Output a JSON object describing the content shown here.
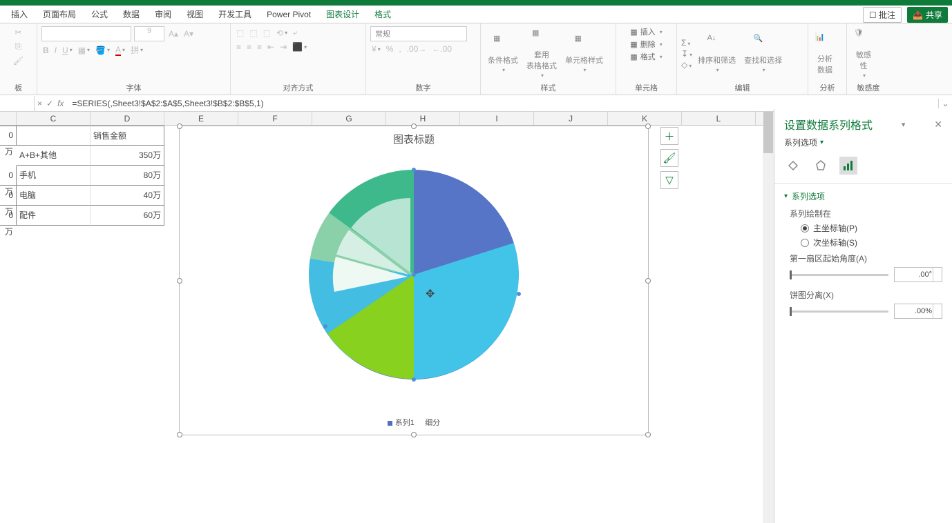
{
  "tabs": [
    "插入",
    "页面布局",
    "公式",
    "数据",
    "审阅",
    "视图",
    "开发工具",
    "Power Pivot",
    "图表设计",
    "格式"
  ],
  "title_right": {
    "comments": "批注",
    "share": "共享"
  },
  "ribbon": {
    "font_size": "9",
    "number_format": "常规",
    "groups": {
      "clipboard": "板",
      "font": "字体",
      "align": "对齐方式",
      "number": "数字",
      "styles": "样式",
      "cells": "单元格",
      "editing": "编辑",
      "analysis": "分析",
      "sensitivity": "敏感度"
    },
    "cond_fmt": "条件格式",
    "table_fmt": "套用\n表格格式",
    "cell_style": "单元格样式",
    "insert": "插入",
    "delete": "删除",
    "format": "格式",
    "sort": "排序和筛选",
    "find": "查找和选择",
    "analyze": "分析\n数据",
    "sens": "敏感\n性"
  },
  "formula_bar": "=SERIES(,Sheet3!$A$2:$A$5,Sheet3!$B$2:$B$5,1)",
  "columns": [
    "C",
    "D",
    "E",
    "F",
    "G",
    "H",
    "I",
    "J",
    "K",
    "L"
  ],
  "table": {
    "header_col2": "销售金额",
    "rows": [
      {
        "a": "0万",
        "c": "A+B+其他",
        "d": "350万"
      },
      {
        "a": "0万",
        "c": "手机",
        "d": "80万"
      },
      {
        "a": "0万",
        "c": "电脑",
        "d": "40万"
      },
      {
        "a": "0万",
        "c": "配件",
        "d": "60万"
      }
    ]
  },
  "chart": {
    "title": "图表标题",
    "legend": [
      "系列1",
      "细分"
    ]
  },
  "chart_data": {
    "type": "pie",
    "title": "图表标题",
    "series": [
      {
        "name": "系列1",
        "categories": [
          "A+B+其他",
          "手机",
          "电脑",
          "配件"
        ],
        "values": [
          350,
          80,
          40,
          60
        ]
      },
      {
        "name": "细分",
        "categories": [
          "手机",
          "电脑",
          "配件"
        ],
        "values": [
          80,
          40,
          60
        ]
      }
    ]
  },
  "panel": {
    "title": "设置数据系列格式",
    "subtitle": "系列选项",
    "section": "系列选项",
    "plot_on": "系列绘制在",
    "primary": "主坐标轴(P)",
    "secondary": "次坐标轴(S)",
    "angle_label": "第一扇区起始角度(A)",
    "angle_value": ".00°",
    "explosion_label": "饼图分离(X)",
    "explosion_value": ".00%"
  }
}
